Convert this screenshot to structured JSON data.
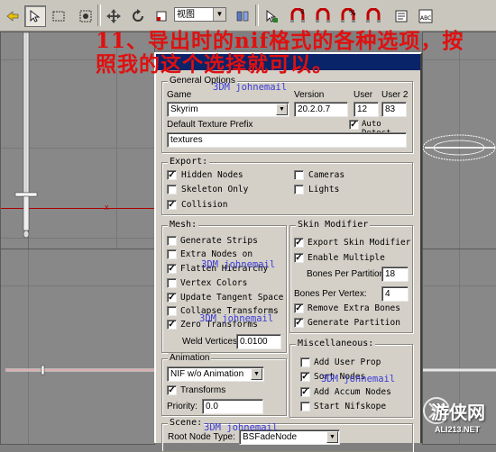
{
  "toolbar": {
    "view_select": "视图",
    "items": [
      "undo-arrow-icon",
      "select-arrow-icon",
      "region-select-icon",
      "window-crossing-icon",
      "move-icon",
      "rotate-icon",
      "scale-icon",
      "snap-2d-icon",
      "angle-snap-icon",
      "percent-snap-icon",
      "spinner-snap-icon",
      "named-selection-icon",
      "abc-icon"
    ],
    "snap_labels": {
      "snap3": "3",
      "snap_angle": "∠",
      "snap_percent": "%"
    }
  },
  "annotation": {
    "title": "11、导出时的nif格式的各种选项，按照我的这个选择就可以。"
  },
  "dialog": {
    "general": {
      "title": "General Options",
      "game_label": "Game",
      "game_value": "Skyrim",
      "version_label": "Version",
      "version_value": "20.2.0.7",
      "user_label": "User",
      "user_value": "12",
      "user2_label": "User 2",
      "user2_value": "83",
      "texture_prefix_label": "Default Texture Prefix",
      "texture_prefix_value": "textures",
      "auto_label": "Auto",
      "auto_checked": true,
      "auto_extra": "Detect"
    },
    "export": {
      "title": "Export:",
      "hidden_nodes": {
        "label": "Hidden Nodes",
        "checked": true
      },
      "skeleton_only": {
        "label": "Skeleton Only",
        "checked": false
      },
      "collision": {
        "label": "Collision",
        "checked": true
      },
      "cameras": {
        "label": "Cameras",
        "checked": false
      },
      "lights": {
        "label": "Lights",
        "checked": false
      }
    },
    "mesh": {
      "title": "Mesh:",
      "generate_strips": {
        "label": "Generate Strips",
        "checked": false
      },
      "extra_nodes": {
        "label": "Extra Nodes on",
        "checked": false
      },
      "flatten_hierarchy": {
        "label": "Flatten Hierarchy",
        "checked": true
      },
      "vertex_colors": {
        "label": "Vertex Colors",
        "checked": false
      },
      "update_tangent": {
        "label": "Update Tangent Space",
        "checked": true
      },
      "collapse_transforms": {
        "label": "Collapse Transforms",
        "checked": false
      },
      "zero_transforms": {
        "label": "Zero Transforms",
        "checked": true
      },
      "weld_label": "Weld Vertices:",
      "weld_value": "0.0100"
    },
    "skin": {
      "title": "Skin Modifier",
      "export_skin": {
        "label": "Export Skin Modifier",
        "checked": true
      },
      "enable_multiple": {
        "label": "Enable Multiple",
        "checked": true
      },
      "bones_partition_label": "Bones Per Partition:",
      "bones_partition_value": "18",
      "bones_vertex_label": "Bones Per Vertex:",
      "bones_vertex_value": "4",
      "remove_extra": {
        "label": "Remove Extra Bones",
        "checked": true
      },
      "generate_partition": {
        "label": "Generate Partition",
        "checked": true
      }
    },
    "animation": {
      "title": "Animation",
      "mode_value": "NIF w/o Animation",
      "transforms": {
        "label": "Transforms",
        "checked": true
      },
      "priority_label": "Priority:",
      "priority_value": "0.0"
    },
    "misc": {
      "title": "Miscellaneous:",
      "add_user_prop": {
        "label": "Add User Prop",
        "checked": false
      },
      "sort_nodes": {
        "label": "Sort Nodes",
        "checked": true
      },
      "add_accum": {
        "label": "Add Accum Nodes",
        "checked": true
      },
      "start_nifskope": {
        "label": "Start Nifskope",
        "checked": false
      }
    },
    "scene": {
      "title": "Scene:",
      "root_label": "Root Node Type:",
      "root_value": "BSFadeNode"
    }
  },
  "watermarks": [
    "3DM johnemail",
    "3DM johnemail",
    "3DM johnemail",
    "3DM johnemail",
    "3DM johnemail"
  ],
  "logo": {
    "big": "游侠网",
    "url": "ALI213.NET"
  },
  "viewport_labels": {
    "x": "x"
  }
}
